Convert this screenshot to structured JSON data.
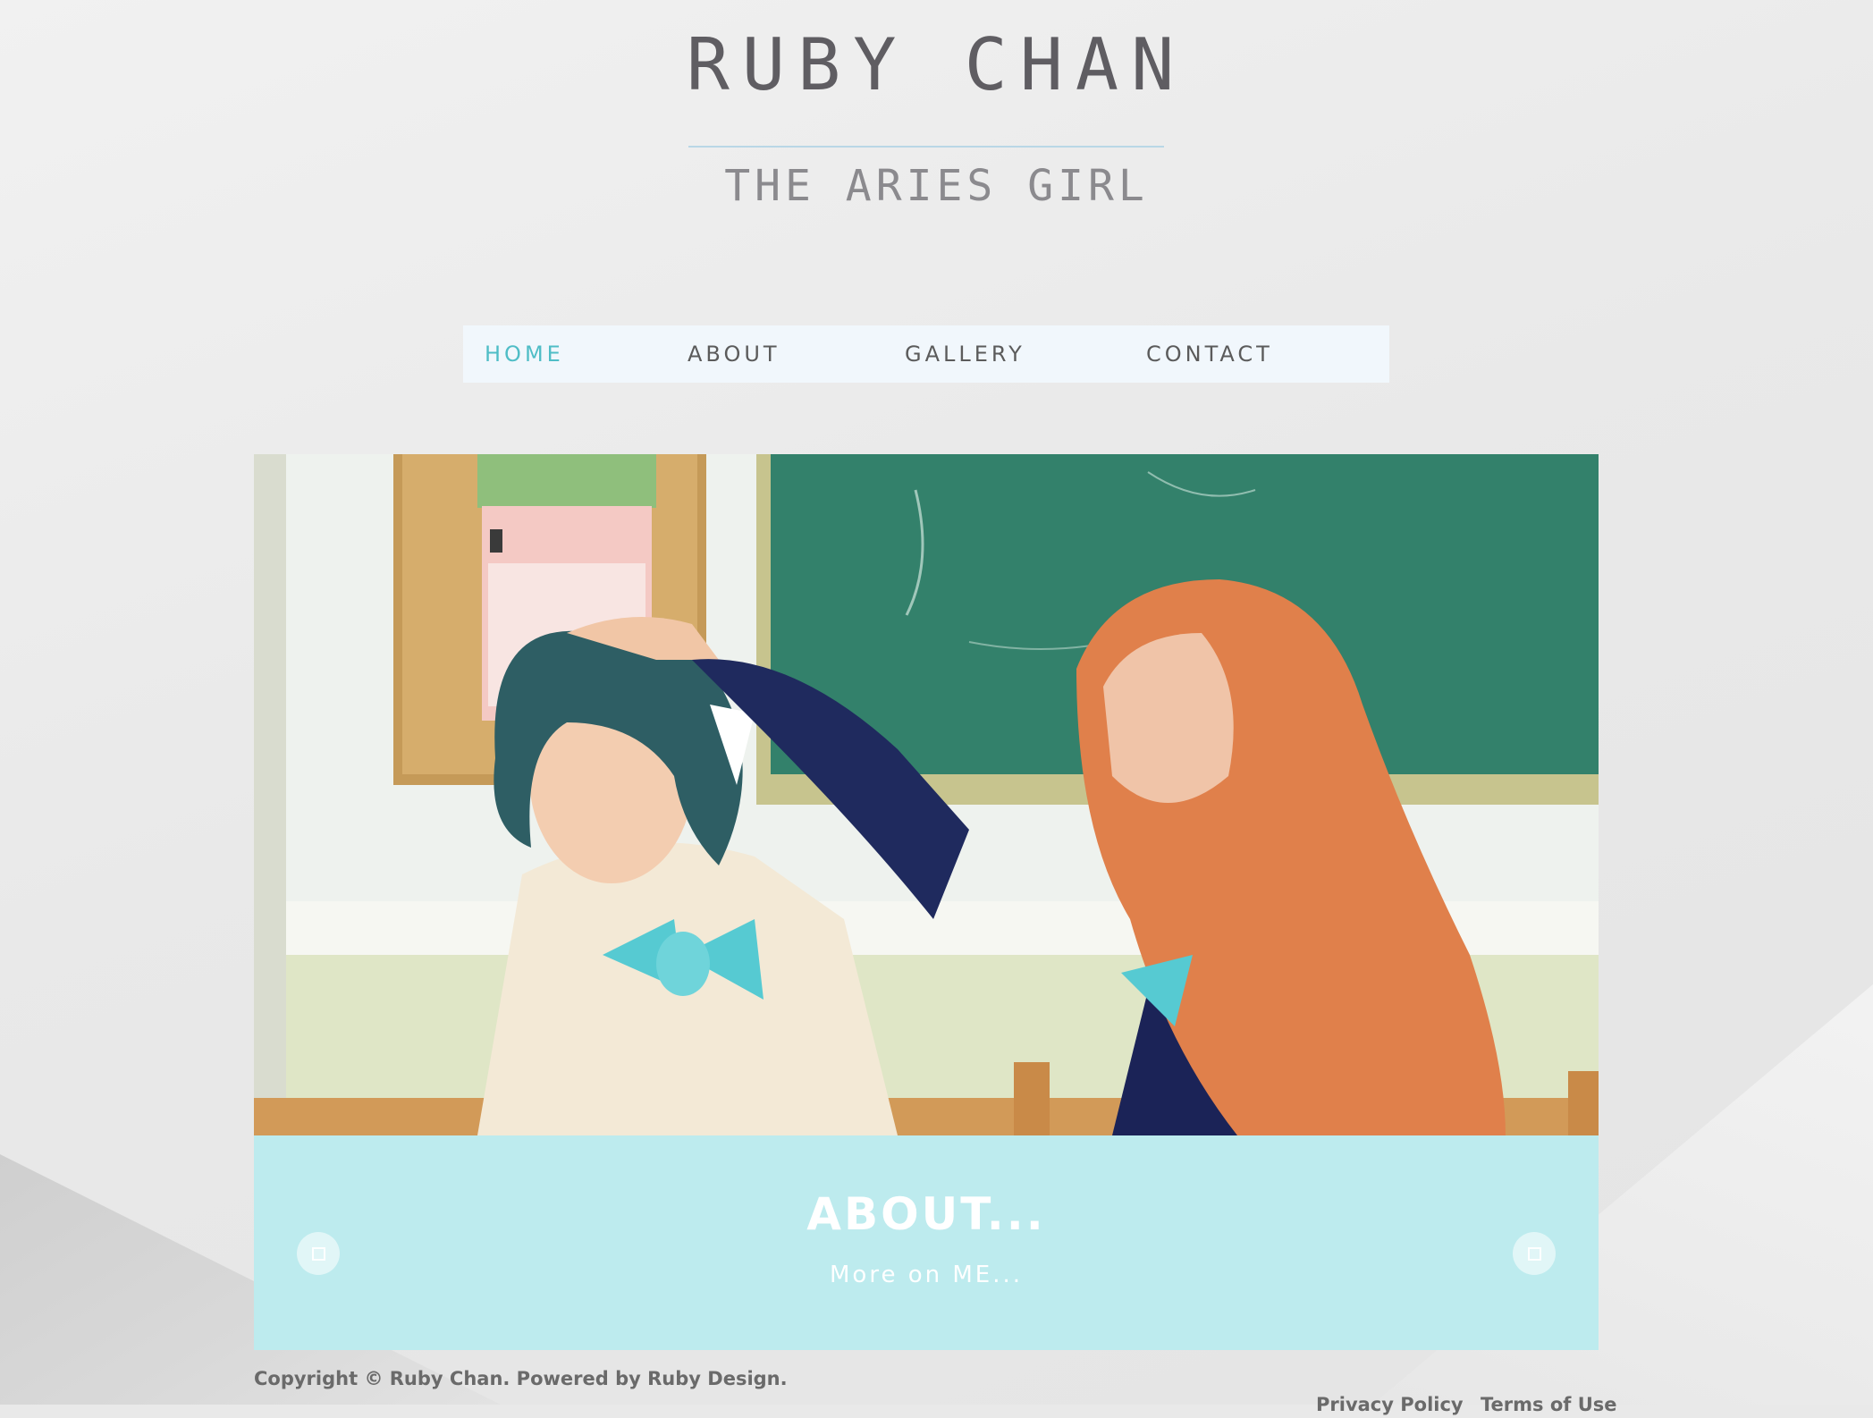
{
  "header": {
    "title": "RUBY CHAN",
    "subtitle": "THE ARIES GIRL"
  },
  "nav": {
    "items": [
      {
        "label": "HOME",
        "active": true
      },
      {
        "label": "ABOUT",
        "active": false
      },
      {
        "label": "GALLERY",
        "active": false
      },
      {
        "label": "CONTACT",
        "active": false
      }
    ]
  },
  "slider": {
    "caption_title": "ABOUT...",
    "caption_subtitle": "More on ME...",
    "prev_icon": "prev-arrow-icon",
    "next_icon": "next-arrow-icon"
  },
  "footer": {
    "copyright": "Copyright © Ruby Chan. Powered by Ruby Design.",
    "links": [
      "Privacy Policy",
      "Terms of Use"
    ]
  },
  "colors": {
    "accent": "#4fbdc6",
    "nav_bg": "#f1f7fc",
    "caption_bg": "#bdebee",
    "title_text": "#5f5d62"
  }
}
